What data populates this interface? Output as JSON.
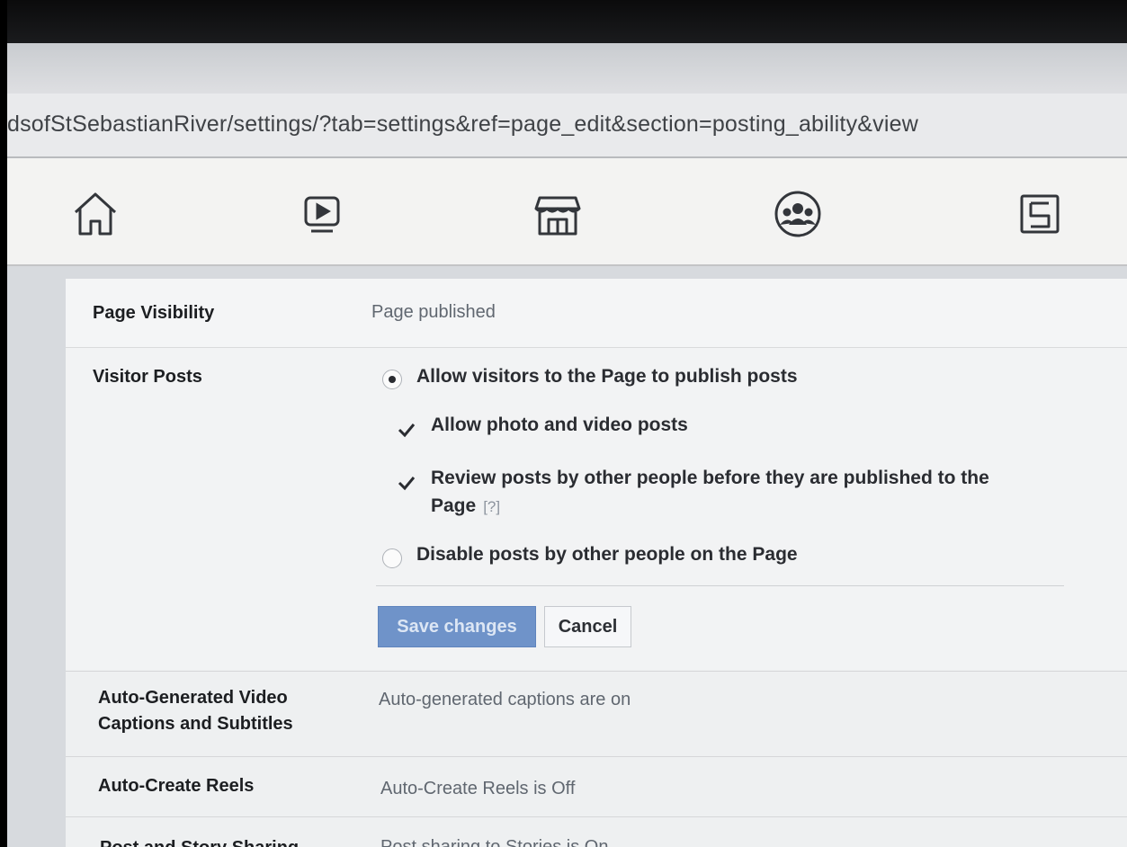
{
  "browser": {
    "url": "dsofStSebastianRiver/settings/?tab=settings&ref=page_edit&section=posting_ability&view"
  },
  "nav": {
    "icons": [
      "home-icon",
      "video-icon",
      "marketplace-icon",
      "groups-icon",
      "gaming-icon"
    ]
  },
  "settings": {
    "page_visibility": {
      "label": "Page Visibility",
      "value": "Page published"
    },
    "visitor_posts": {
      "label": "Visitor Posts",
      "option_allow": "Allow visitors to the Page to publish posts",
      "option_allow_selected": true,
      "check_photo_video": "Allow photo and video posts",
      "check_photo_video_checked": true,
      "check_review_line1": "Review posts by other people before they are published to the",
      "check_review_line2": "Page",
      "check_review_help": "[?]",
      "check_review_checked": true,
      "option_disable": "Disable posts by other people on the Page",
      "option_disable_selected": false,
      "save_label": "Save changes",
      "cancel_label": "Cancel"
    },
    "captions": {
      "label_line1": "Auto-Generated Video",
      "label_line2": "Captions and Subtitles",
      "value": "Auto-generated captions are on"
    },
    "reels": {
      "label": "Auto-Create Reels",
      "value": "Auto-Create Reels is Off"
    },
    "sharing": {
      "label": "Post and Story Sharing",
      "value": "Post sharing to Stories is On"
    }
  },
  "colors": {
    "save_button": "#6f93c9",
    "text_primary": "#1c1e21",
    "text_secondary": "#606770"
  }
}
